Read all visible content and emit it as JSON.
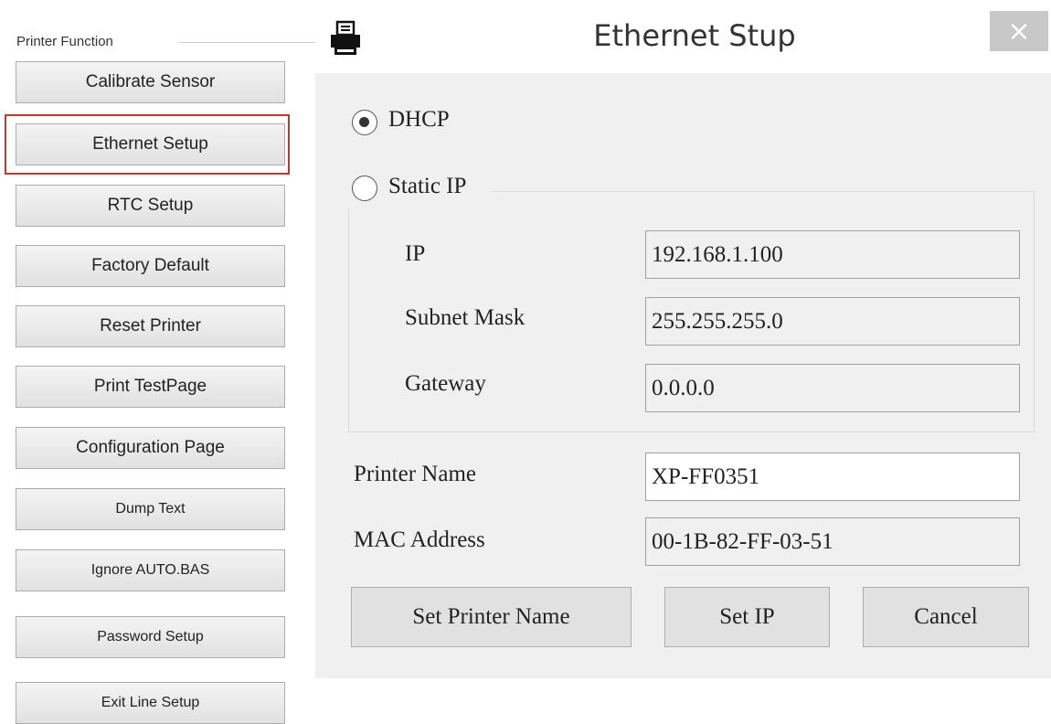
{
  "left_panel": {
    "group_title": "Printer Function",
    "buttons": [
      {
        "label": "Calibrate Sensor"
      },
      {
        "label": "Ethernet Setup"
      },
      {
        "label": "RTC Setup"
      },
      {
        "label": "Factory Default"
      },
      {
        "label": "Reset Printer"
      },
      {
        "label": "Print TestPage"
      },
      {
        "label": "Configuration Page"
      },
      {
        "label": "Dump Text"
      },
      {
        "label": "Ignore AUTO.BAS"
      },
      {
        "label": "Password Setup"
      },
      {
        "label": "Exit Line Setup"
      }
    ],
    "highlight_color": "#c0392b"
  },
  "dialog": {
    "title": "Ethernet Stup",
    "close_glyph": "×",
    "icon": "printer-icon",
    "dhcp": {
      "label": "DHCP",
      "selected": true
    },
    "static_ip": {
      "label": "Static IP",
      "selected": false
    },
    "fields": {
      "ip": {
        "label": "IP",
        "value": "192.168.1.100"
      },
      "subnet": {
        "label": "Subnet Mask",
        "value": "255.255.255.0"
      },
      "gateway": {
        "label": "Gateway",
        "value": "0.0.0.0"
      },
      "printer_name": {
        "label": "Printer Name",
        "value": "XP-FF0351"
      },
      "mac": {
        "label": "MAC Address",
        "value": "00-1B-82-FF-03-51"
      }
    },
    "buttons": {
      "set_printer_name": "Set Printer Name",
      "set_ip": "Set IP",
      "cancel": "Cancel"
    }
  }
}
